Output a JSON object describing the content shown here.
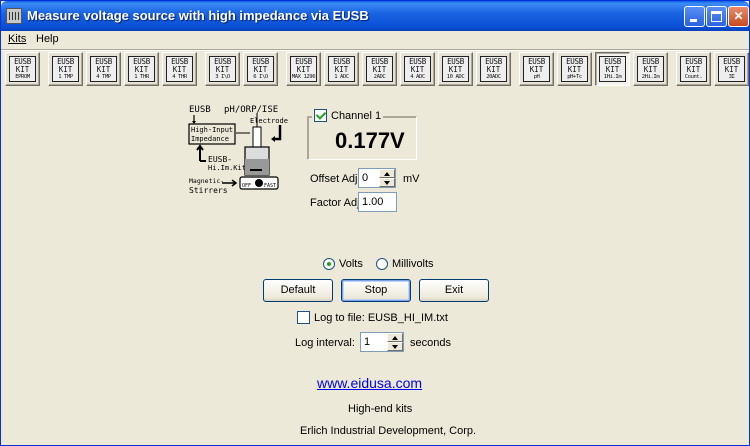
{
  "window": {
    "title": "Measure voltage source with high impedance via EUSB"
  },
  "menu": {
    "kits": "Kits",
    "help": "Help"
  },
  "toolbar": {
    "buttons": [
      {
        "l1": "EUSB",
        "l2": "KIT",
        "l3": "EPROM"
      },
      {
        "l1": "EUSB",
        "l2": "KIT",
        "l3": "1 TMP"
      },
      {
        "l1": "EUSB",
        "l2": "KIT",
        "l3": "4 TMP"
      },
      {
        "l1": "EUSB",
        "l2": "KIT",
        "l3": "1 THR"
      },
      {
        "l1": "EUSB",
        "l2": "KIT",
        "l3": "4 THR"
      },
      {
        "l1": "EUSB",
        "l2": "KIT",
        "l3": "3 I\\O"
      },
      {
        "l1": "EUSB",
        "l2": "KIT",
        "l3": "6 I\\O"
      },
      {
        "l1": "EUSB",
        "l2": "KIT",
        "l3": "MAX 1296"
      },
      {
        "l1": "EUSB",
        "l2": "KIT",
        "l3": "1 ADC"
      },
      {
        "l1": "EUSB",
        "l2": "KIT",
        "l3": "2ADC"
      },
      {
        "l1": "EUSB",
        "l2": "KIT",
        "l3": "4 ADC"
      },
      {
        "l1": "EUSB",
        "l2": "KIT",
        "l3": "10 ADC"
      },
      {
        "l1": "EUSB",
        "l2": "KIT",
        "l3": "20ADC"
      },
      {
        "l1": "EUSB",
        "l2": "KIT",
        "l3": "pH"
      },
      {
        "l1": "EUSB",
        "l2": "KIT",
        "l3": "pH+Tc"
      },
      {
        "l1": "EUSB",
        "l2": "KIT",
        "l3": "1Hi.Im"
      },
      {
        "l1": "EUSB",
        "l2": "KIT",
        "l3": "2Hi.Im"
      },
      {
        "l1": "EUSB",
        "l2": "KIT",
        "l3": "Count."
      },
      {
        "l1": "EUSB",
        "l2": "KIT",
        "l3": "3Σ"
      }
    ]
  },
  "diagram": {
    "eusb": "EUSB",
    "ph_orp": "pH/ORP/ISE",
    "electrode": "Electrode",
    "box_line1": "High-Input",
    "box_line2": "Impedance",
    "kit_line1": "EUSB-",
    "kit_line2": "Hi.Im.Kit",
    "stir_line1": "Magnetic-",
    "stir_line2": "Stirrers",
    "off": "OFF",
    "fast": "FAST"
  },
  "channel": {
    "label": "Channel 1",
    "checked": true,
    "voltage": "0.177V"
  },
  "offset": {
    "label": "Offset Adj.",
    "value": "0",
    "unit": "mV"
  },
  "factor": {
    "label": "Factor Adj.",
    "value": "1.00"
  },
  "units": {
    "volts": "Volts",
    "millivolts": "Millivolts",
    "selected": "Volts"
  },
  "buttons": {
    "default": "Default",
    "stop": "Stop",
    "exit": "Exit"
  },
  "log": {
    "file_label": "Log to file: EUSB_HI_IM.txt",
    "file_checked": false,
    "interval_label": "Log interval:",
    "interval_value": "1",
    "interval_unit": "seconds"
  },
  "footer": {
    "link": "www.eidusa.com",
    "tagline": "High-end kits",
    "company": "Erlich Industrial Development, Corp."
  }
}
